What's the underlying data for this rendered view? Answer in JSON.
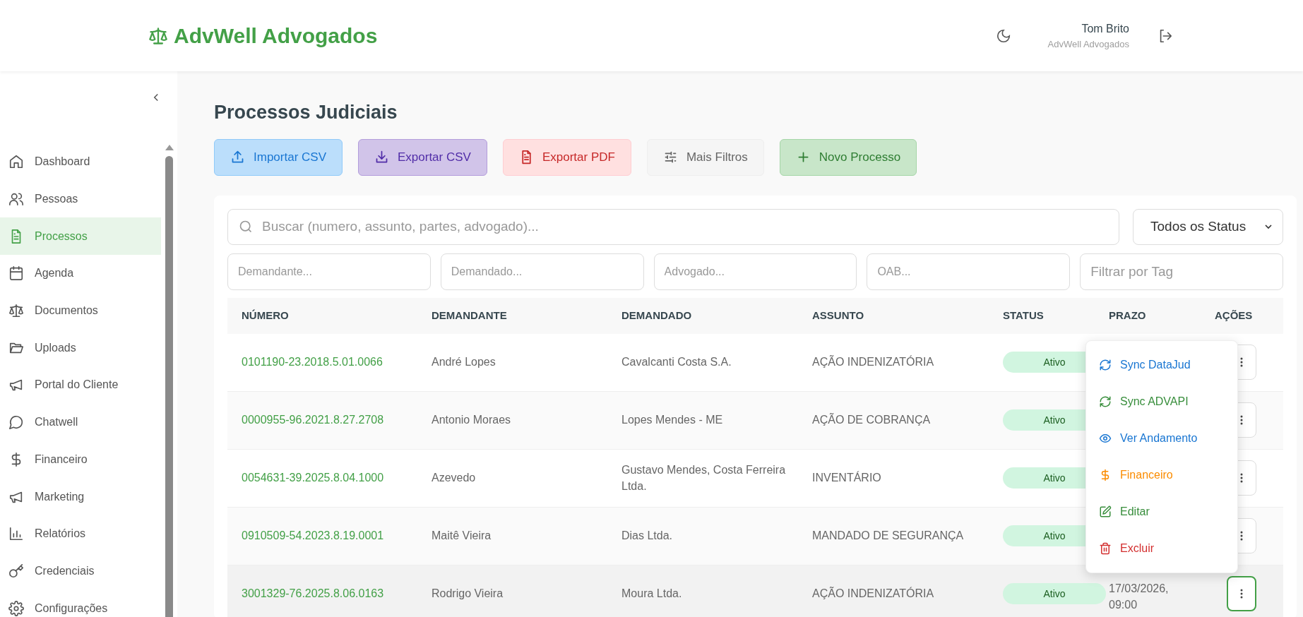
{
  "header": {
    "brand": "AdvWell Advogados",
    "user_name": "Tom Brito",
    "user_org": "AdvWell Advogados"
  },
  "sidebar": {
    "items": [
      {
        "label": "Dashboard",
        "selected": false
      },
      {
        "label": "Pessoas",
        "selected": false
      },
      {
        "label": "Processos",
        "selected": true
      },
      {
        "label": "Agenda",
        "selected": false
      },
      {
        "label": "Documentos",
        "selected": false
      },
      {
        "label": "Uploads",
        "selected": false
      },
      {
        "label": "Portal do Cliente",
        "selected": false
      },
      {
        "label": "Chatwell",
        "selected": false
      },
      {
        "label": "Financeiro",
        "selected": false
      },
      {
        "label": "Marketing",
        "selected": false
      },
      {
        "label": "Relatórios",
        "selected": false
      },
      {
        "label": "Credenciais",
        "selected": false
      },
      {
        "label": "Configurações",
        "selected": false
      }
    ]
  },
  "page_title": "Processos Judiciais",
  "toolbar": [
    {
      "label": "Importar CSV",
      "kind": "import"
    },
    {
      "label": "Exportar CSV",
      "kind": "export"
    },
    {
      "label": "Exportar PDF",
      "kind": "pdf"
    },
    {
      "label": "Mais Filtros",
      "kind": "filters"
    },
    {
      "label": "Novo Processo",
      "kind": "new"
    }
  ],
  "search": {
    "placeholder": "Buscar (numero, assunto, partes, advogado)..."
  },
  "status_select": {
    "value": "Todos os Status"
  },
  "filters": [
    {
      "placeholder": "Demandante..."
    },
    {
      "placeholder": "Demandado..."
    },
    {
      "placeholder": "Advogado..."
    },
    {
      "placeholder": "OAB..."
    },
    {
      "placeholder": "Filtrar por Tag"
    }
  ],
  "table": {
    "columns": [
      "NÚMERO",
      "DEMANDANTE",
      "DEMANDADO",
      "ASSUNTO",
      "STATUS",
      "PRAZO",
      "AÇÕES"
    ],
    "rows": [
      {
        "numero": "0101190-23.2018.5.01.0066",
        "demandante": "André Lopes",
        "demandado": "Cavalcanti Costa S.A.",
        "assunto": "AÇÃO INDENIZATÓRIA",
        "status": "Ativo",
        "menu_open": false
      },
      {
        "numero": "0000955-96.2021.8.27.2708",
        "demandante": "Antonio Moraes",
        "demandado": "Lopes Mendes - ME",
        "assunto": "AÇÃO DE COBRANÇA",
        "status": "Ativo",
        "menu_open": false
      },
      {
        "numero": "0054631-39.2025.8.04.1000",
        "demandante": "Azevedo",
        "demandado": "Gustavo Mendes, Costa Ferreira Ltda.",
        "assunto": "INVENTÁRIO",
        "status": "Ativo",
        "menu_open": false
      },
      {
        "numero": "0910509-54.2023.8.19.0001",
        "demandante": "Maitê Vieira",
        "demandado": "Dias Ltda.",
        "assunto": "MANDADO DE SEGURANÇA",
        "status": "Ativo",
        "menu_open": false
      },
      {
        "numero": "3001329-76.2025.8.06.0163",
        "demandante": "Rodrigo Vieira",
        "demandado": "Moura Ltda.",
        "assunto": "AÇÃO INDENIZATÓRIA",
        "status": "Ativo",
        "prazo": "17/03/2026, 09:00",
        "menu_open": true
      }
    ]
  },
  "action_menu": {
    "items": [
      {
        "label": "Sync DataJud",
        "kind": "sync_datajud"
      },
      {
        "label": "Sync ADVAPI",
        "kind": "sync_advapi"
      },
      {
        "label": "Ver Andamento",
        "kind": "view"
      },
      {
        "label": "Financeiro",
        "kind": "finance"
      },
      {
        "label": "Editar",
        "kind": "edit"
      },
      {
        "label": "Excluir",
        "kind": "delete"
      }
    ]
  }
}
